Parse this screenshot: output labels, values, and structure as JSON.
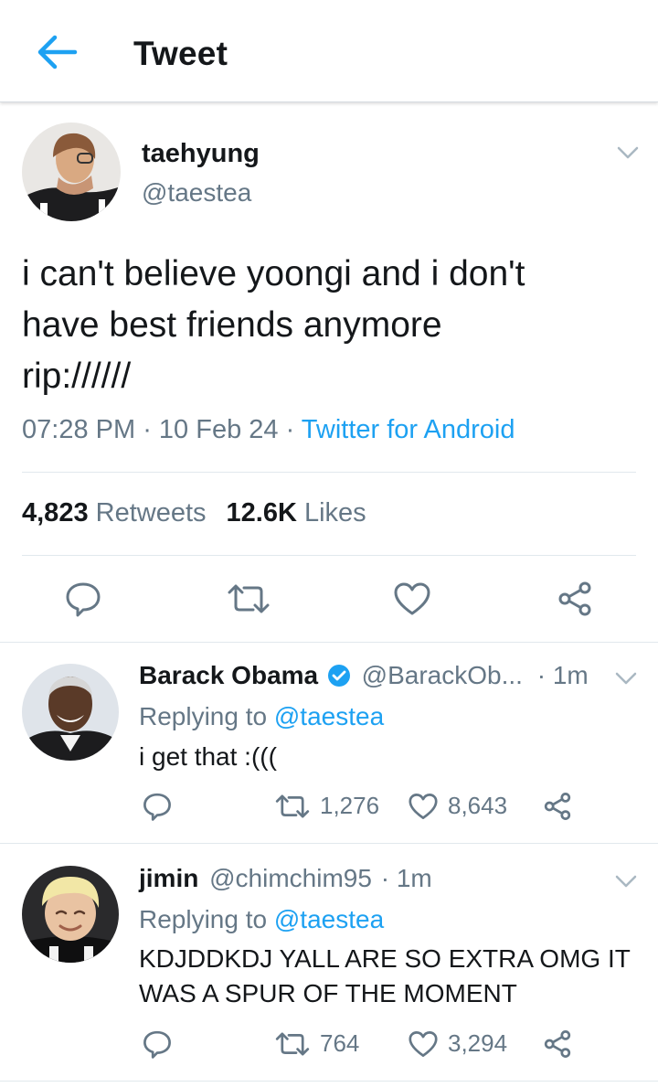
{
  "header": {
    "title": "Tweet",
    "back_icon": "arrow-left-icon",
    "accent": "#1da1f2"
  },
  "tweet": {
    "name": "taehyung",
    "handle": "@taestea",
    "text": "i can't believe yoongi and i don't\nhave best friends anymore\nrip://////",
    "time": "07:28 PM",
    "dot1": " · ",
    "date": "10 Feb 24",
    "dot2": " · ",
    "source": "Twitter for Android",
    "retweets_count": "4,823",
    "retweets_label": "Retweets",
    "likes_count": "12.6K",
    "likes_label": "Likes"
  },
  "replies": [
    {
      "name": "Barack Obama",
      "verified": true,
      "handle": "@BarackOb...",
      "time": "· 1m",
      "replying_label": "Replying to",
      "replying_to": "@taestea",
      "text": "i get that :(((",
      "retweets": "1,276",
      "likes": "8,643"
    },
    {
      "name": "jimin",
      "handle": "@chimchim95",
      "time": "· 1m",
      "replying_label": "Replying to",
      "replying_to": "@taestea",
      "text": "KDJDDKDJ YALL ARE SO EXTRA OMG IT WAS A SPUR OF THE MOMENT",
      "retweets": "764",
      "likes": "3,294"
    }
  ],
  "colors": {
    "text": "#14171a",
    "secondary": "#657786",
    "link": "#1da1f2",
    "border": "#e1e8ed"
  }
}
